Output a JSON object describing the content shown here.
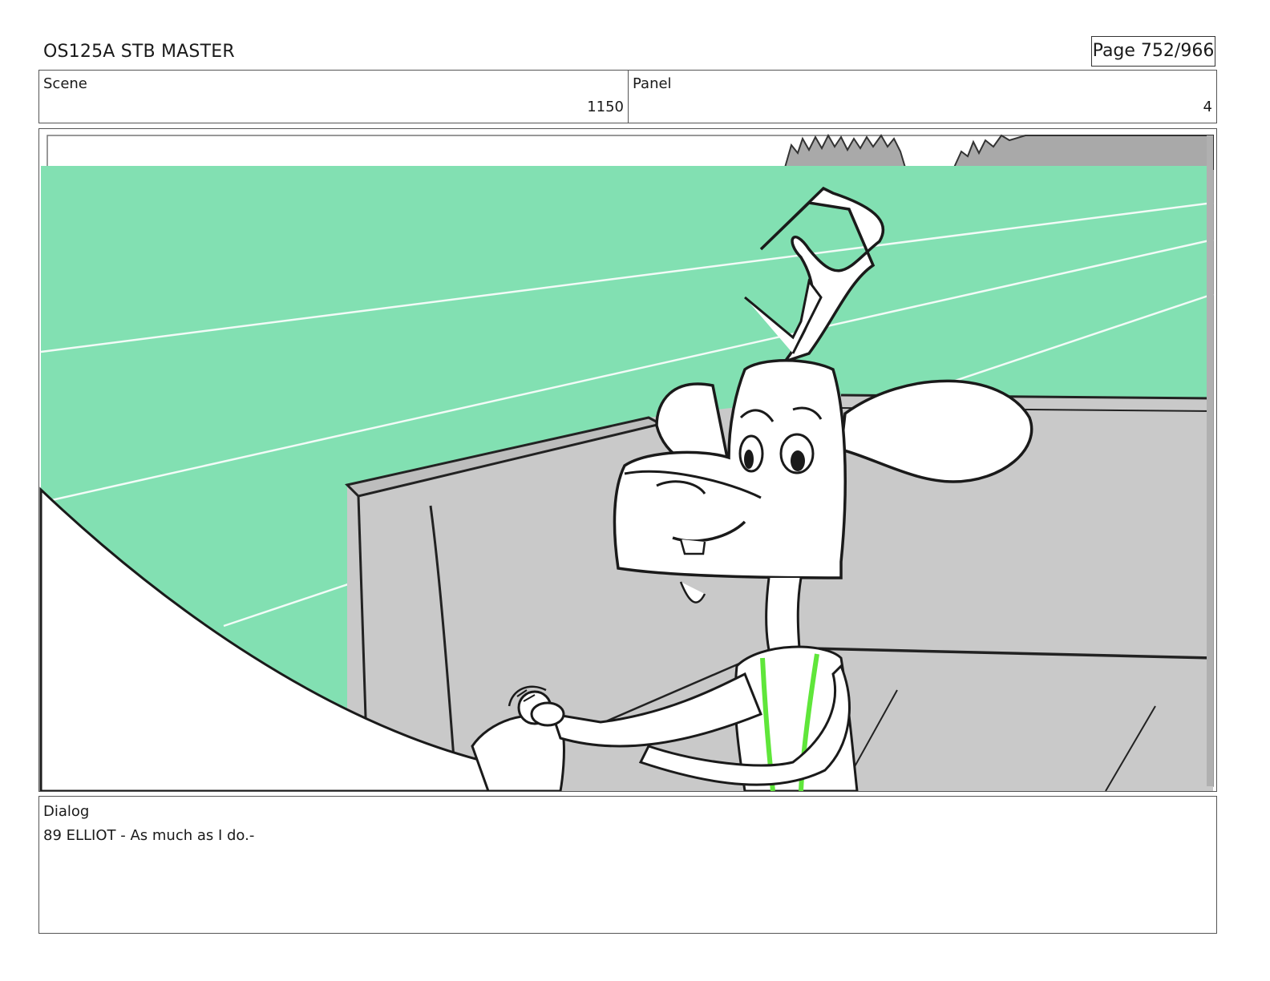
{
  "header": {
    "title": "OS125A STB MASTER",
    "page": "Page 752/966"
  },
  "scene": {
    "label": "Scene",
    "value": "1150"
  },
  "panel": {
    "label": "Panel",
    "value": "4"
  },
  "dialog": {
    "label": "Dialog",
    "text": "89 ELLIOT - As much as I do.-"
  },
  "colors": {
    "sky": "#82e0b2",
    "wall": "#c9c9c9",
    "ground_shadow": "#b0b0b0",
    "sketch_line": "#1a1a1a",
    "accent_green": "#5fe63a"
  }
}
